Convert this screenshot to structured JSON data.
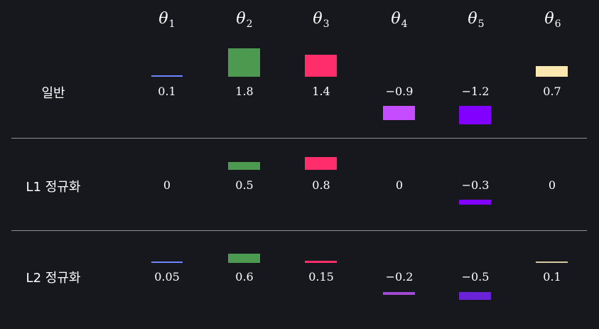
{
  "headers": [
    {
      "symbol": "θ",
      "sub": "1"
    },
    {
      "symbol": "θ",
      "sub": "2"
    },
    {
      "symbol": "θ",
      "sub": "3"
    },
    {
      "symbol": "θ",
      "sub": "4"
    },
    {
      "symbol": "θ",
      "sub": "5"
    },
    {
      "symbol": "θ",
      "sub": "6"
    }
  ],
  "colors": {
    "background": "#16181d",
    "divider": "#8f9296",
    "text": "#ffffff"
  },
  "rows": [
    {
      "label": "일반",
      "cells": [
        {
          "value": 0.1,
          "text": "0.1",
          "color": "#6f86ff"
        },
        {
          "value": 1.8,
          "text": "1.8",
          "color": "#4c9a50"
        },
        {
          "value": 1.4,
          "text": "1.4",
          "color": "#ff2d6a"
        },
        {
          "value": -0.9,
          "text": "−0.9",
          "color": "#c54cff"
        },
        {
          "value": -1.2,
          "text": "−1.2",
          "color": "#8200ff"
        },
        {
          "value": 0.7,
          "text": "0.7",
          "color": "#fae8b0"
        }
      ]
    },
    {
      "label": "L1 정규화",
      "cells": [
        {
          "value": 0,
          "text": "0",
          "color": "#6f86ff"
        },
        {
          "value": 0.5,
          "text": "0.5",
          "color": "#4c9a50"
        },
        {
          "value": 0.8,
          "text": "0.8",
          "color": "#ff2d6a"
        },
        {
          "value": 0,
          "text": "0",
          "color": "#c54cff"
        },
        {
          "value": -0.3,
          "text": "−0.3",
          "color": "#8200ff"
        },
        {
          "value": 0,
          "text": "0",
          "color": "#fae8b0"
        }
      ]
    },
    {
      "label": "L2 정규화",
      "cells": [
        {
          "value": 0.05,
          "text": "0.05",
          "color": "#6f86ff"
        },
        {
          "value": 0.6,
          "text": "0.6",
          "color": "#4c9a50"
        },
        {
          "value": 0.15,
          "text": "0.15",
          "color": "#ff2d6a"
        },
        {
          "value": -0.2,
          "text": "−0.2",
          "color": "#a449d6"
        },
        {
          "value": -0.5,
          "text": "−0.5",
          "color": "#6a22d8"
        },
        {
          "value": 0.1,
          "text": "0.1",
          "color": "#d6c7a1"
        }
      ]
    }
  ]
}
